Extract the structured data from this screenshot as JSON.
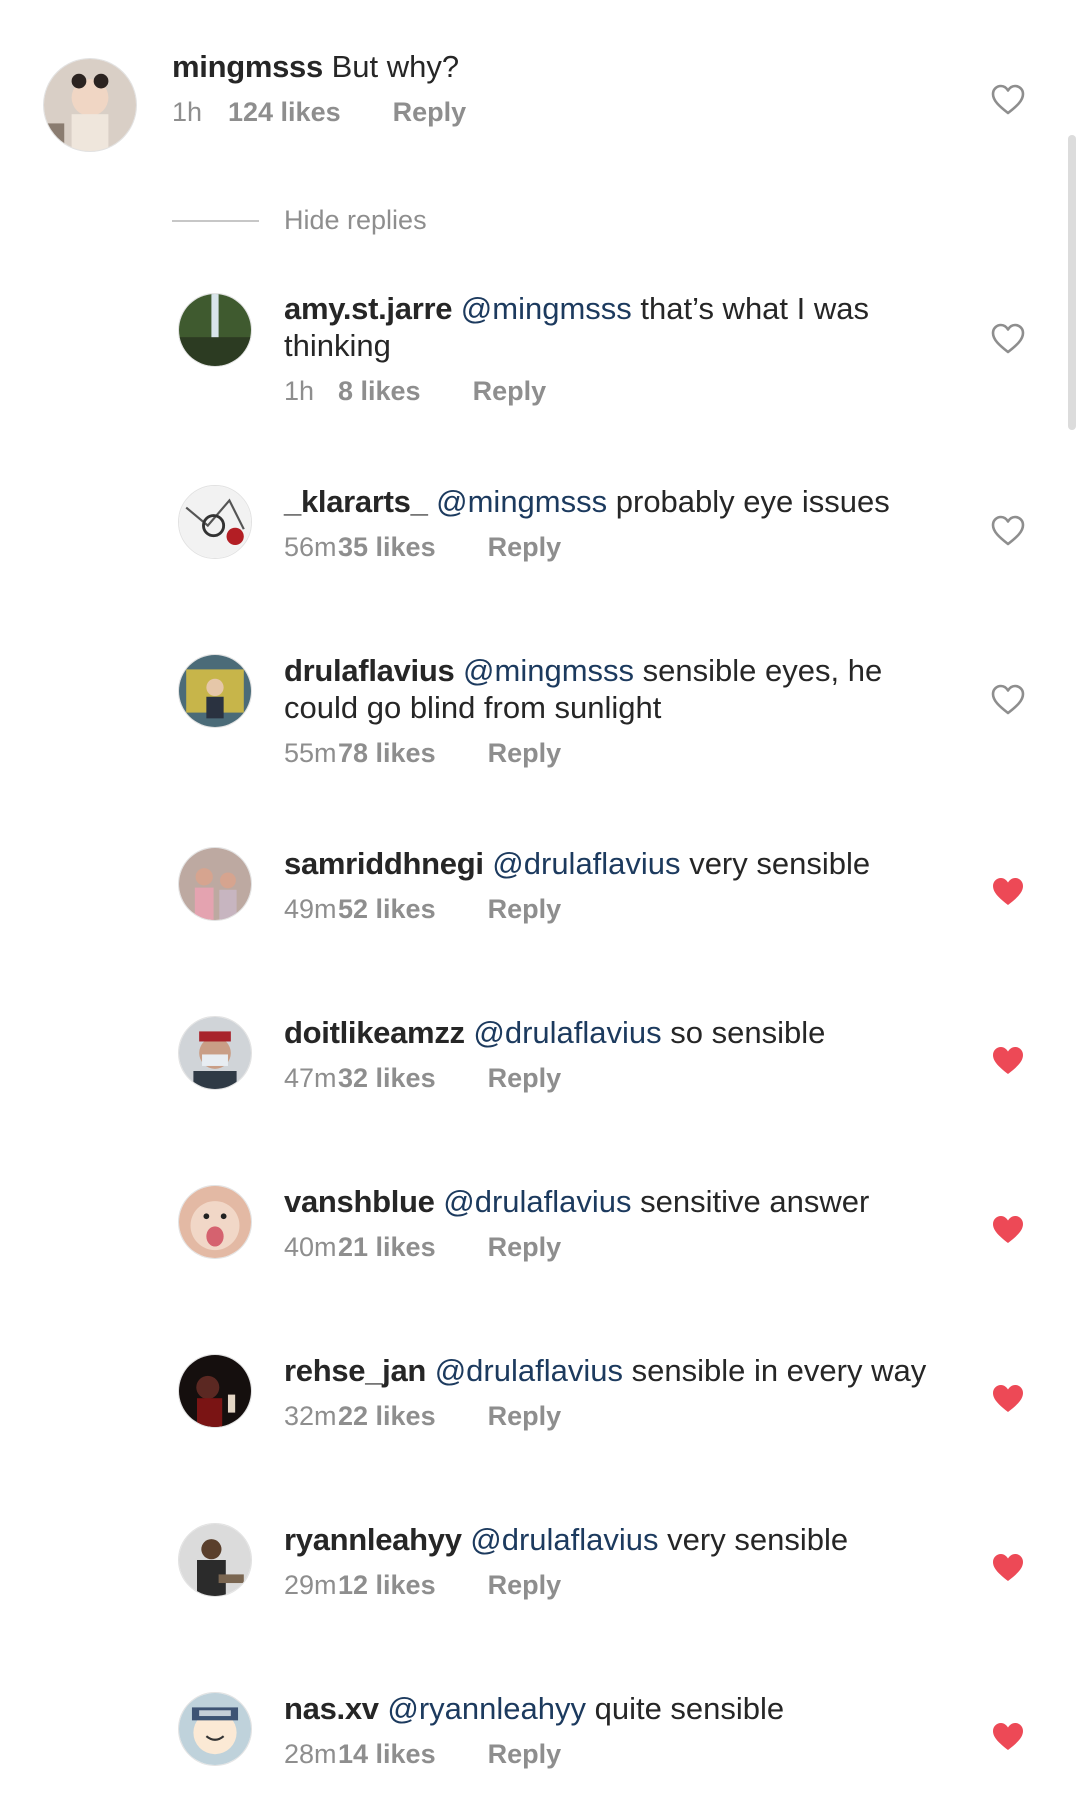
{
  "top_comment": {
    "username": "mingmsss",
    "text": "But why?",
    "time": "1h",
    "likes": "124 likes",
    "reply": "Reply",
    "liked": false
  },
  "hide_replies_label": "Hide replies",
  "replies": [
    {
      "username": "amy.st.jarre",
      "mention": "@mingmsss",
      "text": "that’s what I was thinking",
      "time": "1h",
      "likes": "8 likes",
      "reply": "Reply",
      "liked": false
    },
    {
      "username": "_klararts_",
      "mention": "@mingmsss",
      "text": "probably eye issues",
      "time": "56m",
      "likes": "35 likes",
      "reply": "Reply",
      "liked": false
    },
    {
      "username": "drulaflavius",
      "mention": "@mingmsss",
      "text": "sensible eyes, he could go blind from sunlight",
      "time": "55m",
      "likes": "78 likes",
      "reply": "Reply",
      "liked": false
    },
    {
      "username": "samriddhnegi",
      "mention": "@drulaflavius",
      "text": "very sensible",
      "time": "49m",
      "likes": "52 likes",
      "reply": "Reply",
      "liked": true
    },
    {
      "username": "doitlikeamzz",
      "mention": "@drulaflavius",
      "text": "so sensible",
      "time": "47m",
      "likes": "32 likes",
      "reply": "Reply",
      "liked": true
    },
    {
      "username": "vanshblue",
      "mention": "@drulaflavius",
      "text": "sensitive answer",
      "time": "40m",
      "likes": "21 likes",
      "reply": "Reply",
      "liked": true
    },
    {
      "username": "rehse_jan",
      "mention": "@drulaflavius",
      "text": "sensible in every way",
      "time": "32m",
      "likes": "22 likes",
      "reply": "Reply",
      "liked": true
    },
    {
      "username": "ryannleahyy",
      "mention": "@drulaflavius",
      "text": "very sensible",
      "time": "29m",
      "likes": "12 likes",
      "reply": "Reply",
      "liked": true
    },
    {
      "username": "nas.xv",
      "mention": "@ryannleahyy",
      "text": "quite sensible",
      "time": "28m",
      "likes": "14 likes",
      "reply": "Reply",
      "liked": true
    }
  ],
  "colors": {
    "liked_heart": "#ed4956",
    "unliked_heart": "#8e8e8e",
    "mention": "#1c3a5e",
    "meta_text": "#8e8e8e"
  }
}
